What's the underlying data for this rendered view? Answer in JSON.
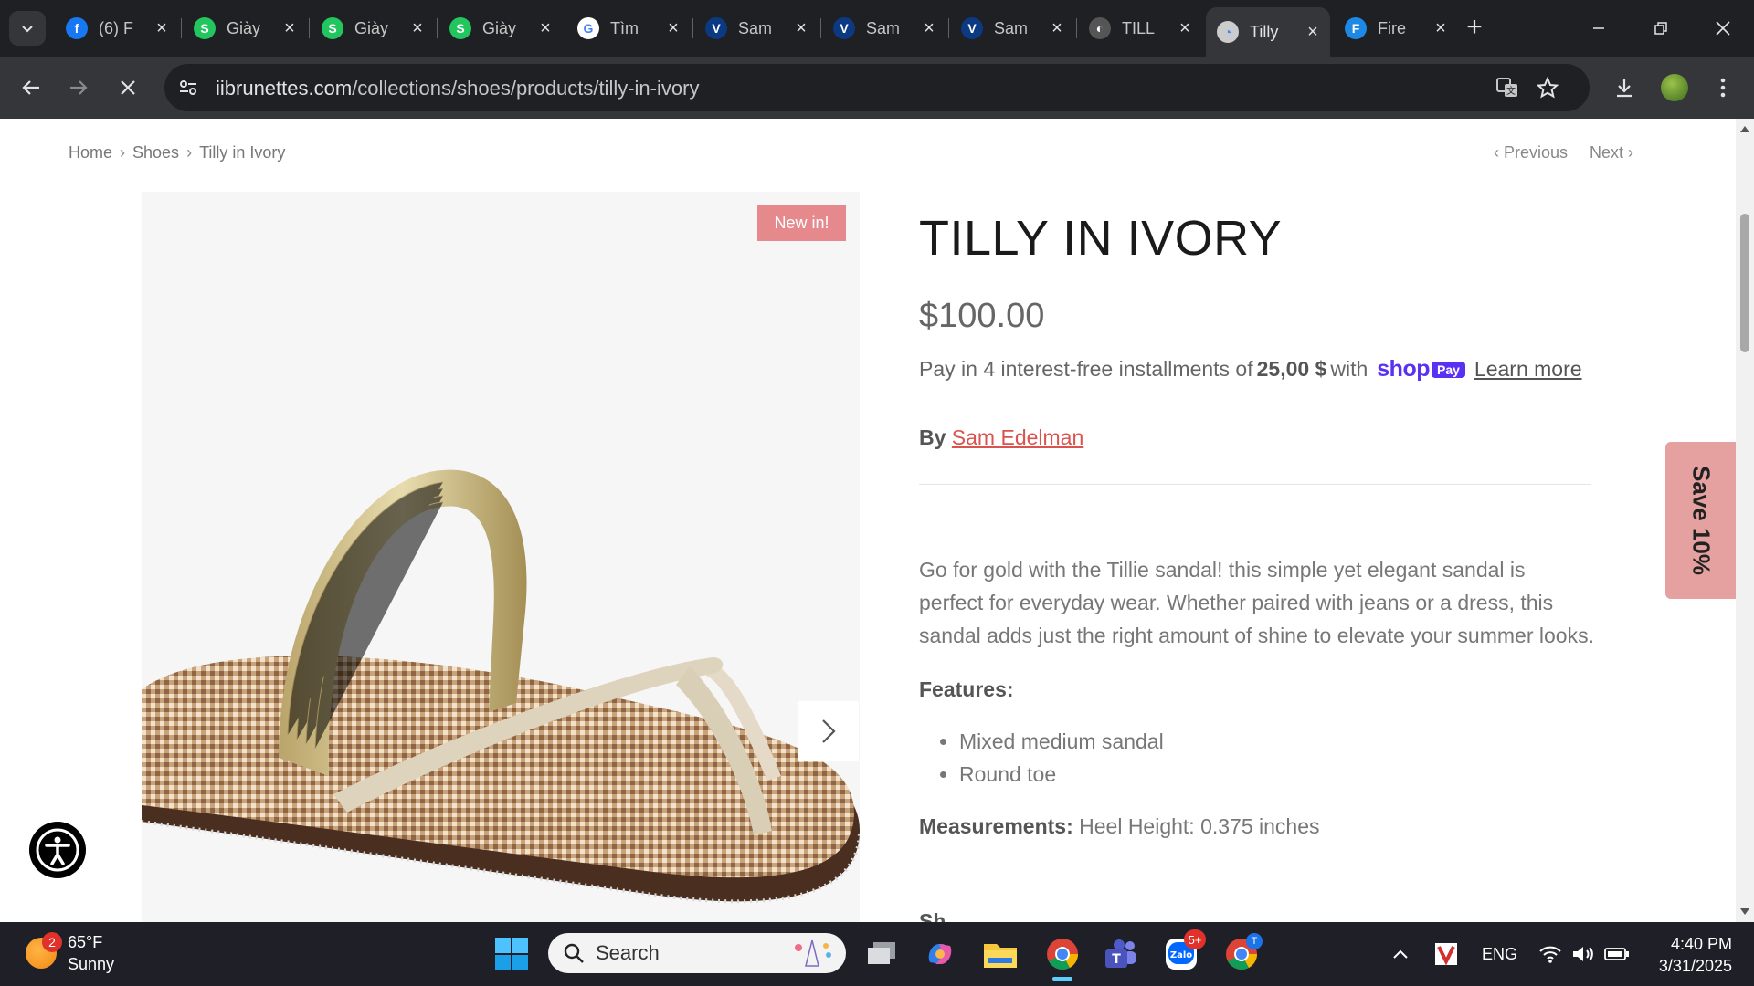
{
  "browser": {
    "tabs": [
      {
        "title": "(6) F",
        "favicon": "facebook-icon",
        "color": "#1877f2",
        "glyph": "f"
      },
      {
        "title": "Giày",
        "favicon": "s-icon",
        "color": "#22c55e",
        "glyph": "S"
      },
      {
        "title": "Giày",
        "favicon": "s-icon",
        "color": "#22c55e",
        "glyph": "S"
      },
      {
        "title": "Giày",
        "favicon": "s-icon",
        "color": "#22c55e",
        "glyph": "S"
      },
      {
        "title": "Tìm",
        "favicon": "google-icon",
        "color": "#ffffff",
        "glyph": "G"
      },
      {
        "title": "Sam",
        "favicon": "v-icon",
        "color": "#0b3a82",
        "glyph": "V"
      },
      {
        "title": "Sam",
        "favicon": "v-icon",
        "color": "#0b3a82",
        "glyph": "V"
      },
      {
        "title": "Sam",
        "favicon": "v-icon",
        "color": "#0b3a82",
        "glyph": "V"
      },
      {
        "title": "TILL",
        "favicon": "swirl-icon",
        "color": "#555555",
        "glyph": "◐"
      },
      {
        "title": "Tilly",
        "favicon": "site-icon",
        "color": "#cccccc",
        "glyph": "◔",
        "active": true
      },
      {
        "title": "Fire",
        "favicon": "firebase-icon",
        "color": "#1e88e5",
        "glyph": "F"
      }
    ],
    "url_host": "iibrunettes.com",
    "url_path": "/collections/shoes/products/tilly-in-ivory"
  },
  "page": {
    "breadcrumb": [
      "Home",
      "Shoes",
      "Tilly in Ivory"
    ],
    "prev_label": "Previous",
    "next_label": "Next",
    "badge": "New in!",
    "title": "TILLY IN IVORY",
    "price": "$100.00",
    "installment_prefix": "Pay in 4 interest-free installments of",
    "installment_amount": "25,00 $",
    "installment_with": "with",
    "shop_label": "shop",
    "pay_label": "Pay",
    "learn_more": "Learn more",
    "by_label": "By",
    "brand": "Sam Edelman",
    "description": "Go for gold with the Tillie sandal! this simple yet elegant sandal is perfect for everyday wear. Whether paired with jeans or a dress, this sandal adds just the right amount of shine to elevate your summer looks.",
    "features_heading": "Features:",
    "features": [
      "Mixed medium sandal",
      "Round toe"
    ],
    "measurements_label": "Measurements:",
    "measurements_value": "Heel Height: 0.375 inches",
    "cut_text": "Sh",
    "save_tab": "Save 10%"
  },
  "taskbar": {
    "weather_temp": "65°F",
    "weather_desc": "Sunny",
    "weather_badge": "2",
    "search_placeholder": "Search",
    "lang": "ENG",
    "zalo_badge": "5+",
    "time": "4:40 PM",
    "date": "3/31/2025"
  },
  "colors": {
    "accent_link": "#d9534f",
    "badge": "#e5898d",
    "shoppay": "#5a31f4",
    "save_tab": "#e5a0a0"
  }
}
